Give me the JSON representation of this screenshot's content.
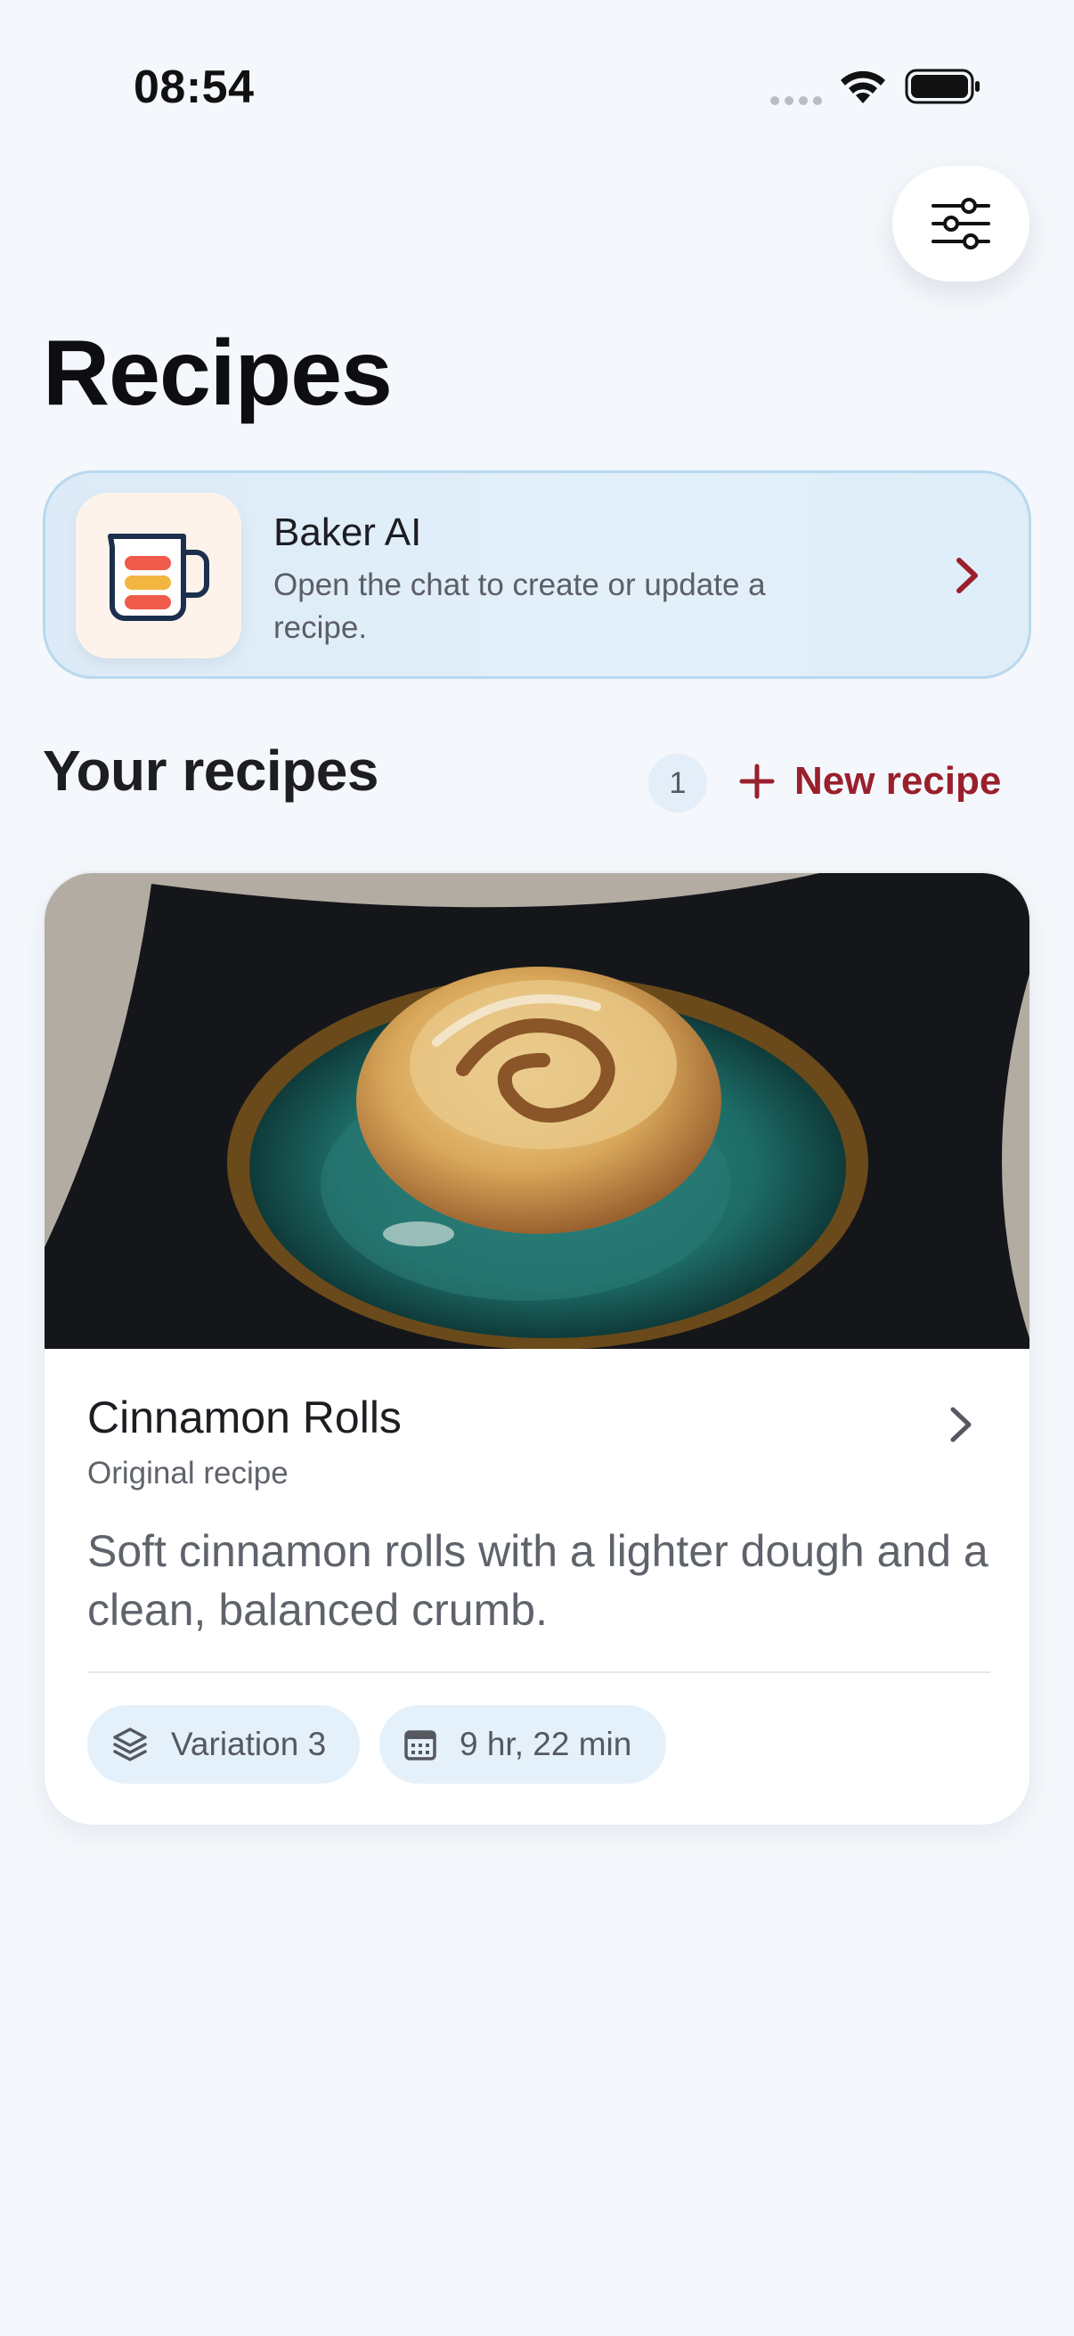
{
  "status_bar": {
    "time": "08:54"
  },
  "header": {
    "title": "Recipes",
    "filter_icon": "sliders-icon"
  },
  "assistant_card": {
    "title": "Baker AI",
    "subtitle": "Open the chat to create or update a recipe.",
    "icon": "measuring-cup-icon"
  },
  "section": {
    "title": "Your recipes",
    "count": "1",
    "new_recipe_label": "New recipe"
  },
  "recipes": [
    {
      "name": "Cinnamon Rolls",
      "type": "Original recipe",
      "description": "Soft cinnamon rolls with a lighter dough and a clean, balanced crumb.",
      "variation_label": "Variation 3",
      "duration_label": "9 hr, 22 min"
    }
  ],
  "colors": {
    "background": "#f4f7fb",
    "accent": "#9a1f2c",
    "card_tint": "#e3f0fa",
    "chip": "#e4f0fa"
  }
}
